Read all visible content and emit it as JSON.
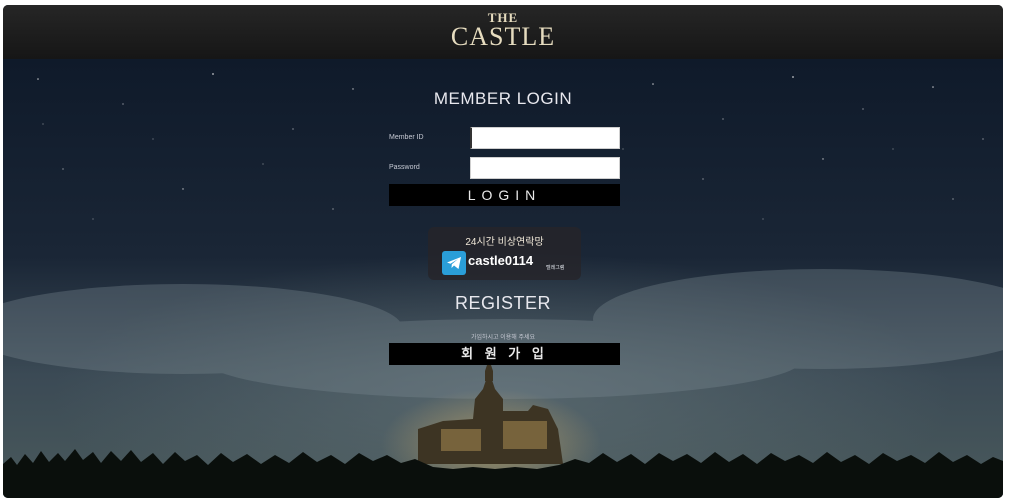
{
  "header": {
    "logo_top": "THE",
    "logo_main": "CASTLE"
  },
  "login": {
    "title": "MEMBER LOGIN",
    "id_label": "Member ID",
    "password_label": "Password",
    "id_value": "",
    "password_value": "",
    "button": "LOGIN"
  },
  "emergency": {
    "text": "24시간 비상연락망",
    "handle": "castle0114",
    "app_label": "텔레그램",
    "icon": "telegram-icon"
  },
  "register": {
    "title": "REGISTER",
    "subtitle": "가입하시고 이용해 주세요",
    "button": "회 원 가 입"
  }
}
